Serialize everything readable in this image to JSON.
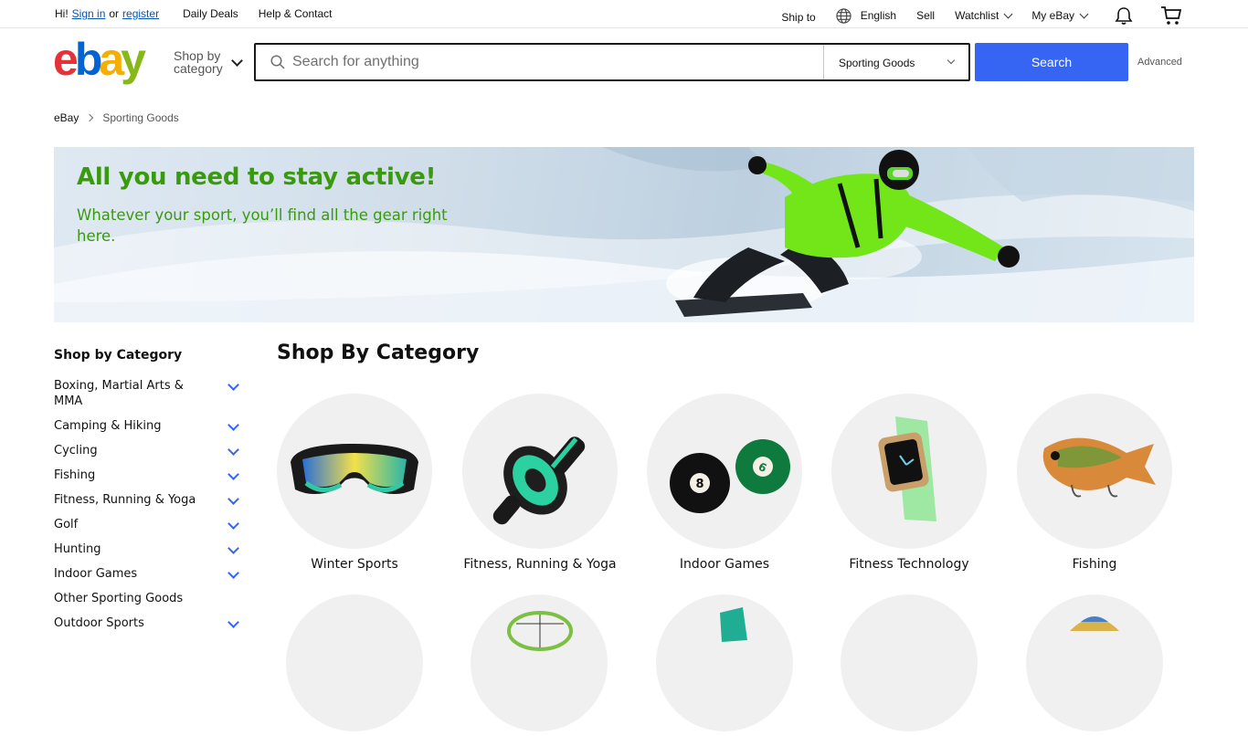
{
  "topbar": {
    "greeting": "Hi!",
    "sign_in": "Sign in",
    "or": "or",
    "register": "register",
    "daily_deals": "Daily Deals",
    "help_contact": "Help & Contact",
    "ship_to": "Ship to",
    "language": "English",
    "sell": "Sell",
    "watchlist": "Watchlist",
    "my_ebay": "My eBay"
  },
  "header": {
    "logo": [
      "e",
      "b",
      "a",
      "y"
    ],
    "shop_by_line1": "Shop by",
    "shop_by_line2": "category",
    "search_placeholder": "Search for anything",
    "category_select": "Sporting Goods",
    "search_button": "Search",
    "advanced": "Advanced"
  },
  "breadcrumb": {
    "home": "eBay",
    "current": "Sporting Goods"
  },
  "hero": {
    "headline": "All you need to stay active!",
    "subline": "Whatever your sport, you’ll find all the gear right here."
  },
  "sidebar": {
    "title": "Shop by Category",
    "items": [
      {
        "label": "Boxing, Martial Arts & MMA"
      },
      {
        "label": "Camping & Hiking"
      },
      {
        "label": "Cycling"
      },
      {
        "label": "Fishing"
      },
      {
        "label": "Fitness, Running & Yoga"
      },
      {
        "label": "Golf"
      },
      {
        "label": "Hunting"
      },
      {
        "label": "Indoor Games"
      },
      {
        "label": "Other Sporting Goods"
      },
      {
        "label": "Outdoor Sports"
      }
    ]
  },
  "main": {
    "title": "Shop By Category",
    "categories": [
      {
        "label": "Winter Sports",
        "icon": "ski-goggles-icon"
      },
      {
        "label": "Fitness, Running & Yoga",
        "icon": "ab-roller-icon"
      },
      {
        "label": "Indoor Games",
        "icon": "billiard-balls-icon"
      },
      {
        "label": "Fitness Technology",
        "icon": "smartwatch-icon"
      },
      {
        "label": "Fishing",
        "icon": "fishing-lure-icon"
      }
    ]
  },
  "colors": {
    "accent": "#3665f3",
    "hero_text": "#3a9a0d",
    "link": "#0654ba"
  }
}
